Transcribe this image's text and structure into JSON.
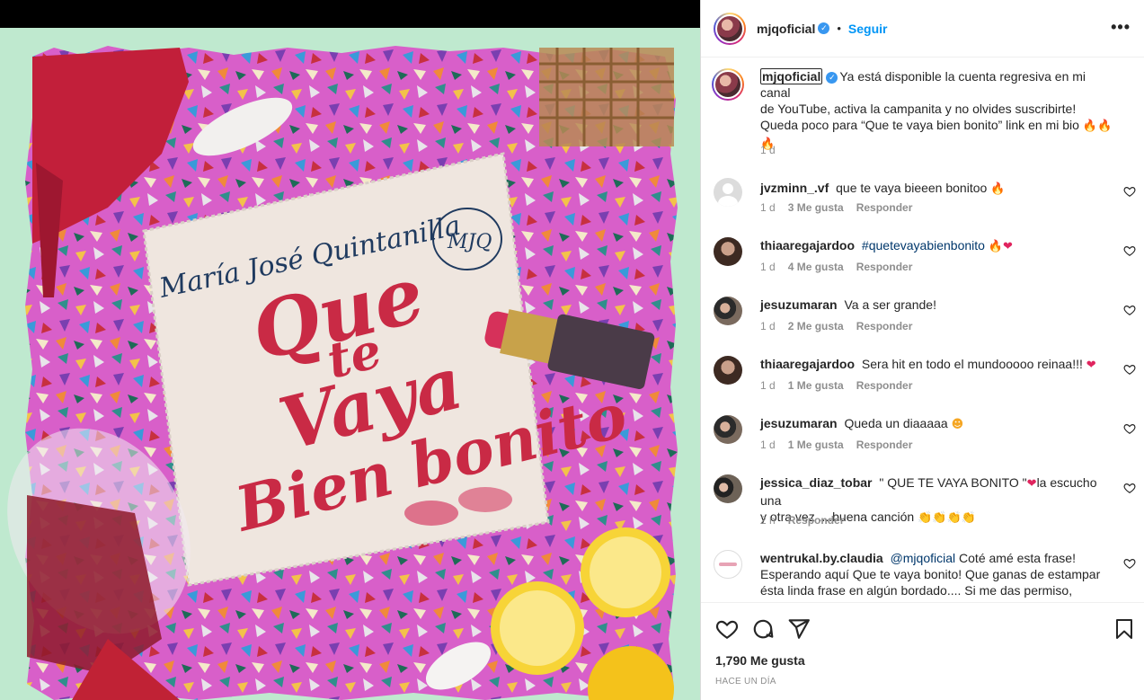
{
  "post": {
    "username": "mjqoficial",
    "follow_label": "Seguir",
    "dot": "•",
    "more": "•••"
  },
  "cover": {
    "artist": "María José Quintanilla",
    "monogram": "MJQ",
    "title_line1": "Que",
    "title_line2": "te",
    "title_line3": "Vaya",
    "title_line4": "Bien bonito",
    "background": "#bfe9cf",
    "paper": "#efe6df",
    "title_color": "#c92a45",
    "accent_pink": "#e24fc8"
  },
  "caption": {
    "username": "mjqoficial",
    "text_line1": "Ya está disponible la cuenta regresiva en mi canal",
    "text_line2": "de YouTube, activa la campanita y no olvides suscribirte!",
    "text_line3": "Queda poco para “Que te vaya bien bonito” link en mi bio",
    "time": "1 d"
  },
  "comments": [
    {
      "username": "jvzminn_.vf",
      "text": "que te vaya bieeen bonitoo",
      "time": "1 d",
      "likes": "3 Me gusta",
      "reply": "Responder"
    },
    {
      "username": "thiaaregajardoo",
      "text": "#quetevayabienbonito",
      "time": "1 d",
      "likes": "4 Me gusta",
      "reply": "Responder"
    },
    {
      "username": "jesuzumaran",
      "text": "Va a ser grande!",
      "time": "1 d",
      "likes": "2 Me gusta",
      "reply": "Responder"
    },
    {
      "username": "thiaaregajardoo",
      "text": "Sera hit en todo el mundooooo reinaa!!!",
      "time": "1 d",
      "likes": "1 Me gusta",
      "reply": "Responder"
    },
    {
      "username": "jesuzumaran",
      "text": "Queda un diaaaaa",
      "time": "1 d",
      "likes": "1 Me gusta",
      "reply": "Responder"
    },
    {
      "username": "jessica_diaz_tobar",
      "text": "\" QUE TE VAYA BONITO \"",
      "text2": "la escucho una",
      "text3": "y otra vez ....buena canción",
      "time": "2 h",
      "reply": "Responder"
    },
    {
      "username": "wentrukal.by.claudia",
      "mention": "@mjqoficial",
      "text": "Coté amé esta frase!",
      "text2": "Esperando aquí Que te vaya bonito! Que ganas de estampar",
      "text3": "ésta linda frase en algún bordado.... Si me das permiso, estaría"
    }
  ],
  "footer": {
    "likes": "1,790 Me gusta",
    "ago": "HACE UN DÍA"
  },
  "icons": [
    "more-icon",
    "verified-icon",
    "heart-icon",
    "comment-icon",
    "share-icon",
    "bookmark-icon"
  ]
}
